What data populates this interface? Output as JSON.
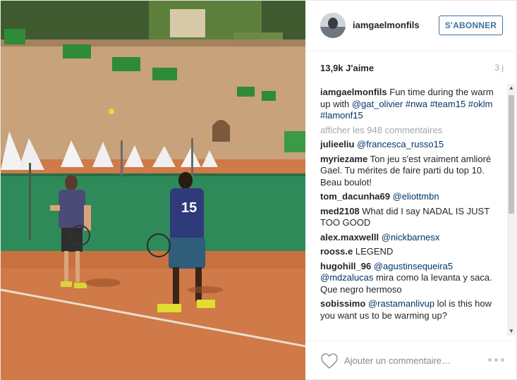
{
  "post": {
    "username": "iamgaelmonfils",
    "follow_label": "S'ABONNER",
    "likes": "13,9k J'aime",
    "age": "3 j",
    "caption": {
      "user": "iamgaelmonfils",
      "text": "Fun time during the warm up with",
      "mention": "@gat_olivier",
      "hashtags": "#nwa #team15 #oklm #lamonf15"
    },
    "view_more": "afficher les 948 commentaires",
    "comments": [
      {
        "user": "julieeliu",
        "text": "",
        "tag": "@francesca_russo15"
      },
      {
        "user": "myriezame",
        "text": "Ton jeu s'est vraiment amlioré Gael. Tu mérites de faire parti du top 10. Beau boulot!",
        "tag": ""
      },
      {
        "user": "tom_dacunha69",
        "text": "",
        "tag": "@eliottmbn"
      },
      {
        "user": "med2108",
        "text": "What did I say NADAL IS JUST TOO GOOD",
        "tag": ""
      },
      {
        "user": "alex.maxwelll",
        "text": "",
        "tag": "@nickbarnesx"
      },
      {
        "user": "rooss.e",
        "text": "LEGEND",
        "tag": ""
      },
      {
        "user": "hugohill_96",
        "text": "",
        "tag": "@agustinsequeira5 @mdzalucas",
        "text_after": "mira como la levanta y saca. Que negro hermoso"
      },
      {
        "user": "sobissimo",
        "text": "",
        "tag": "@rastamanlivup",
        "text_after": "lol is this how you want us to be warming up?"
      }
    ],
    "add_comment_placeholder": "Ajouter un commentaire…",
    "jersey_number": "15"
  },
  "icons": {
    "heart": "heart-icon",
    "more": "more-options-icon",
    "avatar": "avatar"
  },
  "colors": {
    "link": "#003569",
    "follow": "#3f729b",
    "muted": "#a5a7aa",
    "clay": "#cf7a48",
    "fence": "#2f8a5a"
  }
}
